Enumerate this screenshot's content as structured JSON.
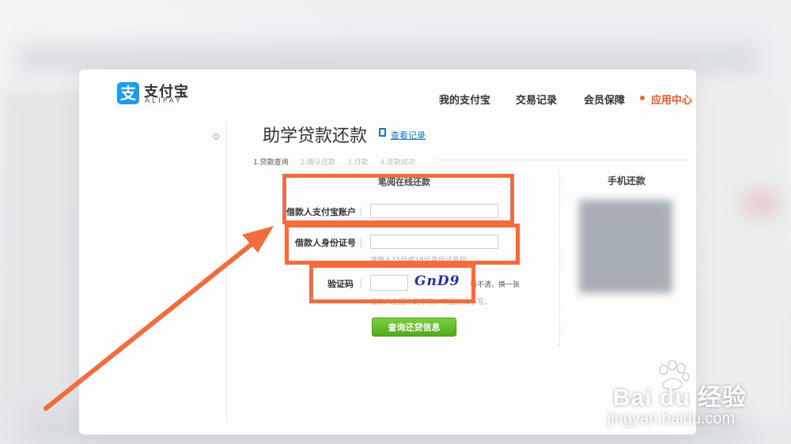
{
  "header": {
    "logo_cn": "支付宝",
    "logo_en": "ALIPAY",
    "logo_glyph": "支",
    "nav": [
      "我的支付宝",
      "交易记录",
      "会员保障",
      "应用中心"
    ],
    "active_nav_color": "#e8582a"
  },
  "page": {
    "title": "助学贷款还款",
    "record_link": "查看记录"
  },
  "steps": [
    "1.贷款查询",
    "2.确认还款",
    "3.付款",
    "4.还款成功"
  ],
  "form": {
    "section_title": "笔阅在线还款",
    "account_label": "借款人支付宝账户",
    "account_value": "",
    "id_label": "借款人身份证号",
    "id_value": "",
    "id_hint": "请输入15位或18位身份证号码。",
    "captcha_label": "验证码",
    "captcha_value": "",
    "captcha_text": "GnD9",
    "captcha_refresh": "看不清，换一张",
    "captcha_hint": "请输入上图中的字符，不区分大小写。",
    "submit_label": "查询还贷信息"
  },
  "side": {
    "mobile_title": "手机还款"
  },
  "watermark": {
    "brand": "Bai du 经验",
    "url": "jingyan.baidu.com"
  },
  "colors": {
    "brand_blue": "#1a9df0",
    "highlight": "#f26c3d",
    "submit_green": "#5fb52a",
    "link_blue": "#1a78c2"
  }
}
